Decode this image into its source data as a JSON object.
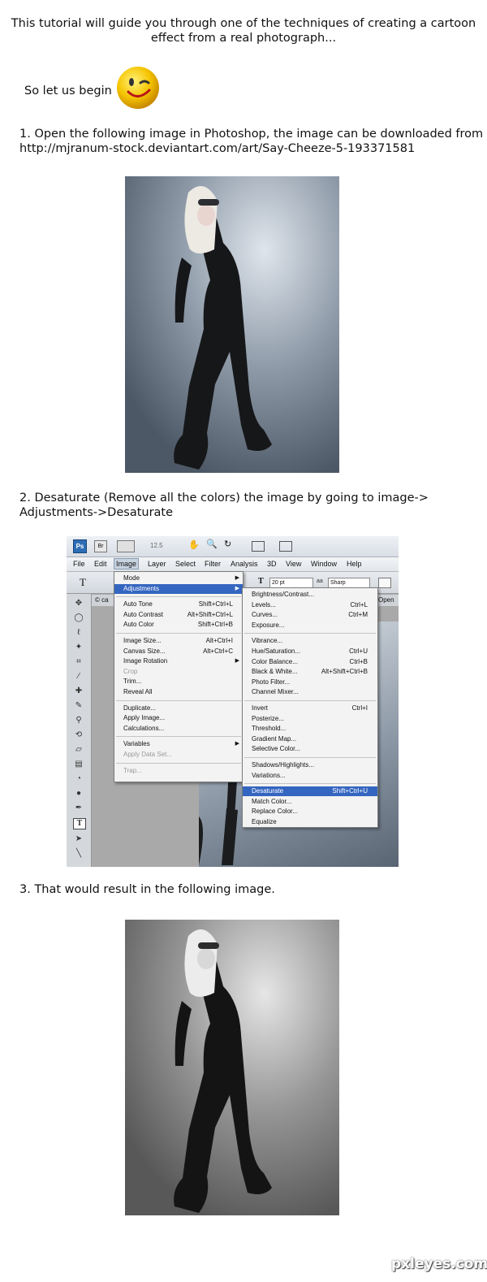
{
  "intro": {
    "line1": "This tutorial will guide you through one of the techniques of creating a cartoon",
    "line2": "effect from a real photograph...",
    "begin": "So let us begin"
  },
  "steps": {
    "s1_line1": "1. Open the following image in Photoshop, the image can be downloaded from",
    "s1_line2": "http://mjranum-stock.deviantart.com/art/Say-Cheeze-5-193371581",
    "s2_line1": "2. Desaturate (Remove all the colors) the image by going to image->",
    "s2_line2": "Adjustments->Desaturate",
    "s3": "3. That would result in the following image."
  },
  "photoshop": {
    "zoom": "12.5",
    "menus": [
      "File",
      "Edit",
      "Image",
      "Layer",
      "Select",
      "Filter",
      "Analysis",
      "3D",
      "View",
      "Window",
      "Help"
    ],
    "font_size": "20 pt",
    "antialias": "Sharp",
    "tab_label": "© ca",
    "open_label": "Open",
    "image_menu": [
      {
        "label": "Mode",
        "shortcut": "",
        "arrow": true
      },
      {
        "label": "Adjustments",
        "shortcut": "",
        "arrow": true,
        "selected": true
      },
      {
        "label": "Auto Tone",
        "shortcut": "Shift+Ctrl+L"
      },
      {
        "label": "Auto Contrast",
        "shortcut": "Alt+Shift+Ctrl+L"
      },
      {
        "label": "Auto Color",
        "shortcut": "Shift+Ctrl+B"
      },
      {
        "label": "Image Size...",
        "shortcut": "Alt+Ctrl+I"
      },
      {
        "label": "Canvas Size...",
        "shortcut": "Alt+Ctrl+C"
      },
      {
        "label": "Image Rotation",
        "shortcut": "",
        "arrow": true
      },
      {
        "label": "Crop",
        "shortcut": "",
        "disabled": true
      },
      {
        "label": "Trim...",
        "shortcut": ""
      },
      {
        "label": "Reveal All",
        "shortcut": ""
      },
      {
        "label": "Duplicate...",
        "shortcut": ""
      },
      {
        "label": "Apply Image...",
        "shortcut": ""
      },
      {
        "label": "Calculations...",
        "shortcut": ""
      },
      {
        "label": "Variables",
        "shortcut": "",
        "arrow": true
      },
      {
        "label": "Apply Data Set...",
        "shortcut": "",
        "disabled": true
      },
      {
        "label": "Trap...",
        "shortcut": "",
        "disabled": true
      }
    ],
    "adjustments_menu": [
      {
        "label": "Brightness/Contrast...",
        "shortcut": ""
      },
      {
        "label": "Levels...",
        "shortcut": "Ctrl+L"
      },
      {
        "label": "Curves...",
        "shortcut": "Ctrl+M"
      },
      {
        "label": "Exposure...",
        "shortcut": ""
      },
      {
        "label": "Vibrance...",
        "shortcut": ""
      },
      {
        "label": "Hue/Saturation...",
        "shortcut": "Ctrl+U"
      },
      {
        "label": "Color Balance...",
        "shortcut": "Ctrl+B"
      },
      {
        "label": "Black & White...",
        "shortcut": "Alt+Shift+Ctrl+B"
      },
      {
        "label": "Photo Filter...",
        "shortcut": ""
      },
      {
        "label": "Channel Mixer...",
        "shortcut": ""
      },
      {
        "label": "Invert",
        "shortcut": "Ctrl+I"
      },
      {
        "label": "Posterize...",
        "shortcut": ""
      },
      {
        "label": "Threshold...",
        "shortcut": ""
      },
      {
        "label": "Gradient Map...",
        "shortcut": ""
      },
      {
        "label": "Selective Color...",
        "shortcut": ""
      },
      {
        "label": "Shadows/Highlights...",
        "shortcut": ""
      },
      {
        "label": "Variations...",
        "shortcut": ""
      },
      {
        "label": "Desaturate",
        "shortcut": "Shift+Ctrl+U",
        "selected": true
      },
      {
        "label": "Match Color...",
        "shortcut": ""
      },
      {
        "label": "Replace Color...",
        "shortcut": ""
      },
      {
        "label": "Equalize",
        "shortcut": ""
      }
    ]
  },
  "watermark": "pxleyes.com",
  "colors": {
    "menu_highlight": "#3465c0",
    "photo_bg_color": "#8794a3",
    "photo_bg_gray": "#8c8c8c",
    "smiley": "#f5c400"
  }
}
